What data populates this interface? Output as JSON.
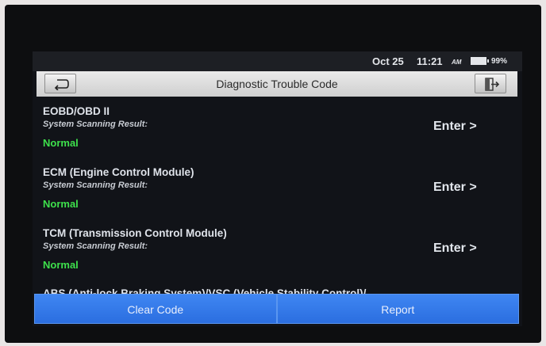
{
  "status_bar": {
    "date": "Oct 25",
    "time": "11:21",
    "ampm": "AM",
    "battery": "99%"
  },
  "header": {
    "title": "Diagnostic Trouble Code",
    "back_icon": "back-arrow-icon",
    "exit_icon": "exit-icon"
  },
  "modules": [
    {
      "name": "EOBD/OBD II",
      "label": "System Scanning Result:",
      "status": "Normal",
      "action": "Enter >"
    },
    {
      "name": "ECM (Engine Control Module)",
      "label": "System Scanning Result:",
      "status": "Normal",
      "action": "Enter >"
    },
    {
      "name": "TCM (Transmission Control Module)",
      "label": "System Scanning Result:",
      "status": "Normal",
      "action": "Enter >"
    },
    {
      "name": "ABS (Anti-lock Braking System)/VSC (Vehicle Stability Control)/"
    }
  ],
  "footer": {
    "clear_code": "Clear Code",
    "report": "Report"
  },
  "colors": {
    "status_normal": "#3ee04c",
    "button_blue": "#2f74e6",
    "title_bar": "#d9d9d9"
  }
}
